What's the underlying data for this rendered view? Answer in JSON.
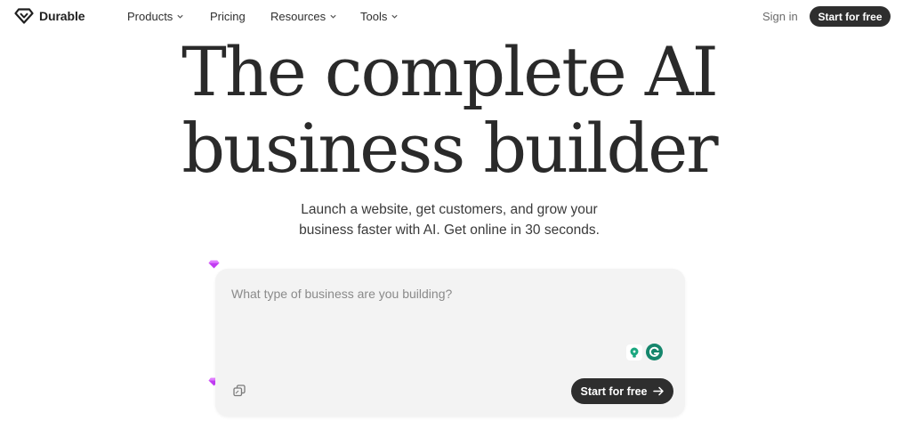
{
  "brand": {
    "name": "Durable",
    "logo_icon": "diamond-logo-icon"
  },
  "nav": {
    "items": [
      {
        "label": "Products",
        "has_dropdown": true
      },
      {
        "label": "Pricing",
        "has_dropdown": false
      },
      {
        "label": "Resources",
        "has_dropdown": true
      },
      {
        "label": "Tools",
        "has_dropdown": true
      }
    ],
    "sign_in_label": "Sign in",
    "cta_label": "Start for free"
  },
  "hero": {
    "title_line_1": "The complete AI",
    "title_line_2": "business builder",
    "subtitle_line_1": "Launch a website, get customers, and grow your",
    "subtitle_line_2": "business faster with AI. Get online in 30 seconds."
  },
  "prompt": {
    "placeholder": "What type of business are you building?",
    "value": "",
    "submit_label": "Start for free",
    "submit_icon": "arrow-right-icon",
    "extension_icons": [
      "lightbulb-icon",
      "grammarly-icon"
    ],
    "attach_icon": "copy-icon"
  },
  "colors": {
    "button_bg": "#2e2e2e",
    "card_bg": "#f3f3f3",
    "gem_purple": "#c13cf2",
    "grammarly_green": "#15866c"
  }
}
